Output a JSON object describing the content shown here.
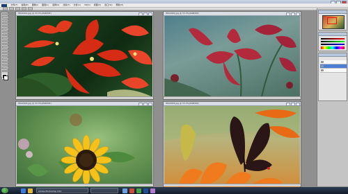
{
  "window": {
    "title": ""
  },
  "menu": {
    "items": [
      "文件(F)",
      "编辑(E)",
      "图像(I)",
      "图层(L)",
      "选择(S)",
      "滤镜(T)",
      "分析(A)",
      "3D(D)",
      "视图(V)",
      "窗口(W)",
      "帮助(H)"
    ]
  },
  "documents": [
    {
      "title": "IMG0001.jpg @ 33.3%(RGB/8#)",
      "subject": "red-lilies"
    },
    {
      "title": "IMG0002.jpg @ 33.3%(RGB/8#)",
      "subject": "pink-lily"
    },
    {
      "title": "IMG0003.jpg @ 33.3%(RGB/8#)",
      "subject": "sunflower"
    },
    {
      "title": "IMG0004.jpg @ 33.3%(RGB/8#)",
      "subject": "butterfly-on-lily"
    }
  ],
  "taskbar": {
    "buttons": [
      "Adobe Photoshop CS4",
      ""
    ],
    "time": "",
    "date": ""
  },
  "colors": {
    "accent": "#4b7fd6",
    "taskbar": "#1a2436"
  }
}
